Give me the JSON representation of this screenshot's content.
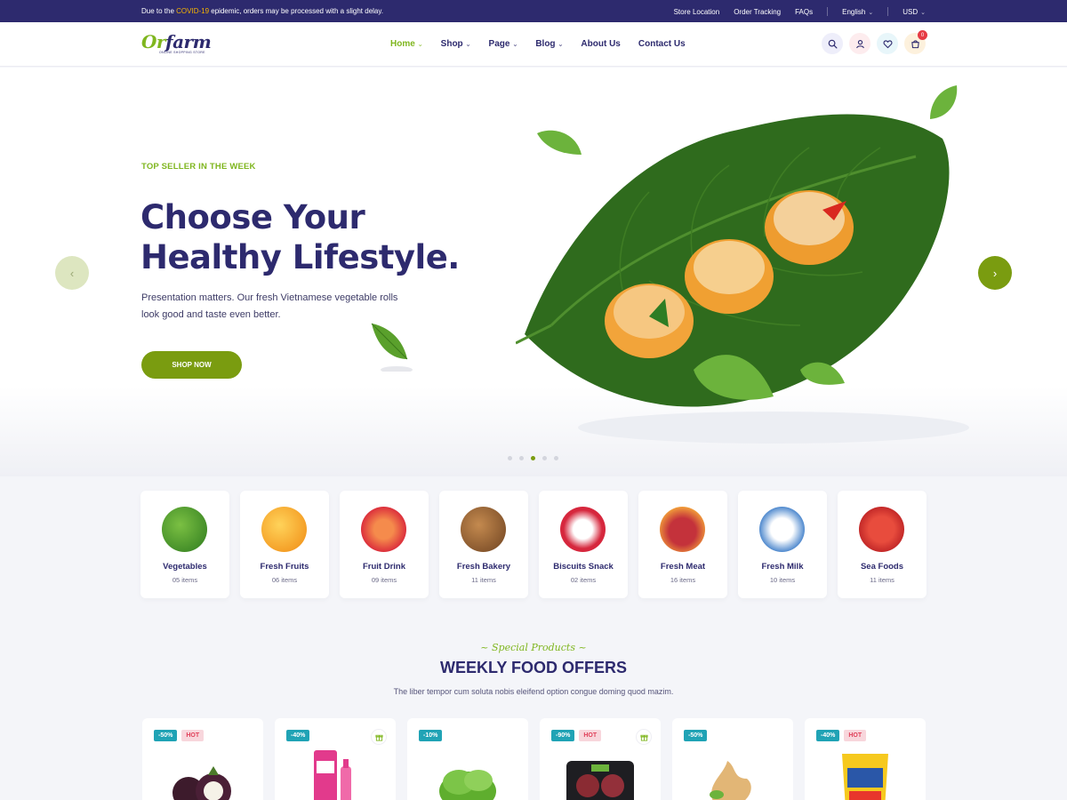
{
  "topbar": {
    "notice_prefix": "Due to the ",
    "notice_highlight": "COVID-19",
    "notice_suffix": " epidemic, orders may be processed with a slight delay.",
    "links": [
      "Store Location",
      "Order Tracking",
      "FAQs"
    ],
    "language": "English",
    "currency": "USD"
  },
  "header": {
    "logo_text_a": "Or",
    "logo_text_b": "farm",
    "logo_sub": "ONLINE SHOPPING STORE",
    "nav": [
      {
        "label": "Home",
        "has_dropdown": true,
        "active": true
      },
      {
        "label": "Shop",
        "has_dropdown": true
      },
      {
        "label": "Page",
        "has_dropdown": true
      },
      {
        "label": "Blog",
        "has_dropdown": true
      },
      {
        "label": "About Us",
        "has_dropdown": false
      },
      {
        "label": "Contact Us",
        "has_dropdown": false
      }
    ],
    "cart_count": "0",
    "icons": [
      "search-icon",
      "user-icon",
      "heart-icon",
      "cart-icon"
    ]
  },
  "hero": {
    "eyebrow": "TOP SELLER IN THE WEEK",
    "title_line1": "Choose Your",
    "title_line2": "Healthy Lifestyle.",
    "desc_line1": "Presentation matters. Our fresh Vietnamese vegetable rolls",
    "desc_line2": "look good and taste even better.",
    "cta": "SHOP NOW",
    "slides": 5,
    "active_slide": 3
  },
  "categories": [
    {
      "name": "Vegetables",
      "count": "05 items",
      "color": "#3f8f25"
    },
    {
      "name": "Fresh Fruits",
      "count": "06 items",
      "color": "#f7a21b"
    },
    {
      "name": "Fruit Drink",
      "count": "09 items",
      "color": "#e8603b"
    },
    {
      "name": "Fresh Bakery",
      "count": "11 items",
      "color": "#8a5a2c"
    },
    {
      "name": "Biscuits Snack",
      "count": "02 items",
      "color": "#d6273d"
    },
    {
      "name": "Fresh Meat",
      "count": "16 items",
      "color": "#c4323b"
    },
    {
      "name": "Fresh Milk",
      "count": "10 items",
      "color": "#3a7bc8"
    },
    {
      "name": "Sea Foods",
      "count": "11 items",
      "color": "#d8302b"
    }
  ],
  "section": {
    "tag": "~ Special Products ~",
    "title": "WEEKLY FOOD OFFERS",
    "desc": "The liber tempor cum soluta nobis eleifend option congue doming quod mazim."
  },
  "products": [
    {
      "discount": "-50%",
      "hot": "HOT",
      "gift": false
    },
    {
      "discount": "-40%",
      "hot": "",
      "gift": true
    },
    {
      "discount": "-10%",
      "hot": "",
      "gift": false
    },
    {
      "discount": "-90%",
      "hot": "HOT",
      "gift": true
    },
    {
      "discount": "-50%",
      "hot": "",
      "gift": false
    },
    {
      "discount": "-40%",
      "hot": "HOT",
      "gift": false
    }
  ],
  "colors": {
    "brand_navy": "#2d2a6e",
    "brand_green": "#7a9c10",
    "accent_green": "#7fb61f",
    "discount_teal": "#20a3b5",
    "hot_pink": "#e0405a"
  }
}
